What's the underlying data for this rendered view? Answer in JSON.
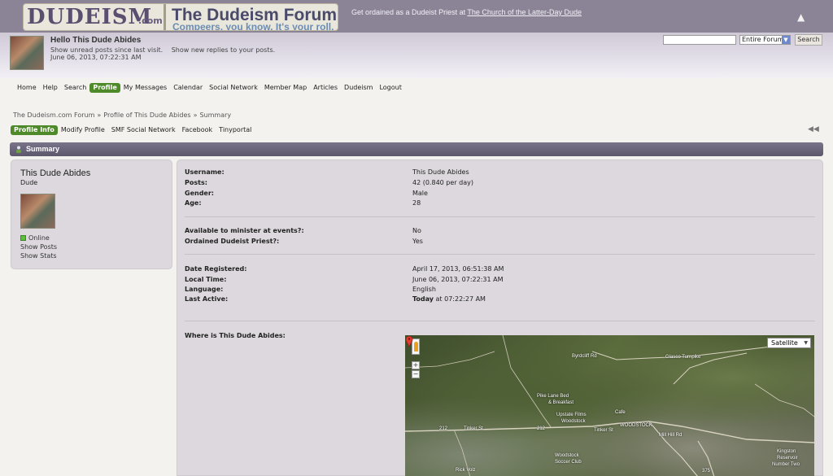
{
  "header": {
    "logo_text": "DUDEISM",
    "logo_suffix": ".com",
    "forum_name": "The Dudeism Forum",
    "tagline": "Compeers, you know. It's your roll.",
    "ordain_text": "Get ordained as a Dudeist Priest at ",
    "ordain_link": "The Church of the Latter-Day Dude",
    "collapse_icon": "▲"
  },
  "user": {
    "greeting": "Hello This Dude Abides",
    "unread_posts": "Show unread posts since last visit.",
    "new_replies": "Show new replies to your posts.",
    "date": "June 06, 2013, 07:22:31 AM"
  },
  "search": {
    "query": "",
    "scope": "Entire Forum",
    "button": "Search"
  },
  "menu": {
    "items": [
      "Home",
      "Help",
      "Search",
      "Profile",
      "My Messages",
      "Calendar",
      "Social Network",
      "Member Map",
      "Articles",
      "Dudeism",
      "Logout"
    ],
    "active": "Profile"
  },
  "breadcrumb": {
    "items": [
      "The Dudeism.com Forum",
      "Profile of This Dude Abides",
      "Summary"
    ],
    "separator": "»"
  },
  "submenu": {
    "items": [
      "Profile Info",
      "Modify Profile",
      "SMF Social Network",
      "Facebook",
      "Tinyportal"
    ],
    "active": "Profile Info",
    "collapse_icon": "◀◀"
  },
  "section": {
    "title": "Summary"
  },
  "profile_card": {
    "name": "This Dude Abides",
    "title": "Dude",
    "status": "Online",
    "show_posts": "Show Posts",
    "show_stats": "Show Stats"
  },
  "details": {
    "username_label": "Username:",
    "username": "This Dude Abides",
    "posts_label": "Posts:",
    "posts": "42 (0.840 per day)",
    "gender_label": "Gender:",
    "gender": "Male",
    "age_label": "Age:",
    "age": "28",
    "minister_label": "Available to minister at events?:",
    "minister": "No",
    "priest_label": "Ordained Dudeist Priest?:",
    "priest": "Yes",
    "registered_label": "Date Registered:",
    "registered": "April 17, 2013, 06:51:38 AM",
    "localtime_label": "Local Time:",
    "localtime": "June 06, 2013, 07:22:31 AM",
    "language_label": "Language:",
    "language": "English",
    "lastactive_label": "Last Active:",
    "lastactive_bold": "Today",
    "lastactive_rest": " at 07:22:27 AM",
    "location_label": "Where is This Dude Abides:"
  },
  "map": {
    "type_button": "Satellite",
    "zoom_in": "+",
    "zoom_out": "−",
    "labels": {
      "byrdcliff": "Byrdcliff Rd",
      "classic": "Glasco Turnpike",
      "pike": "Pike Lane Bed",
      "breakfast": "& Breakfast",
      "upstate": "Upstate Films",
      "upstate2": "Woodstock",
      "woodstock": "WOODSTOCK",
      "tinker": "Tinker St",
      "tinker2": "Tinker St",
      "route212a": "212",
      "route212b": "212",
      "route375": "375",
      "soccer": "Woodstock",
      "soccer2": "Soccer Club",
      "millhill": "Mill Hill Rd",
      "kingston": "Kingston",
      "kingston2": "Reservoir",
      "kingston3": "Number Two",
      "rick": "Rick Volz",
      "cafe": "Cafe",
      "glasco": "Glasco Turnpike"
    }
  }
}
